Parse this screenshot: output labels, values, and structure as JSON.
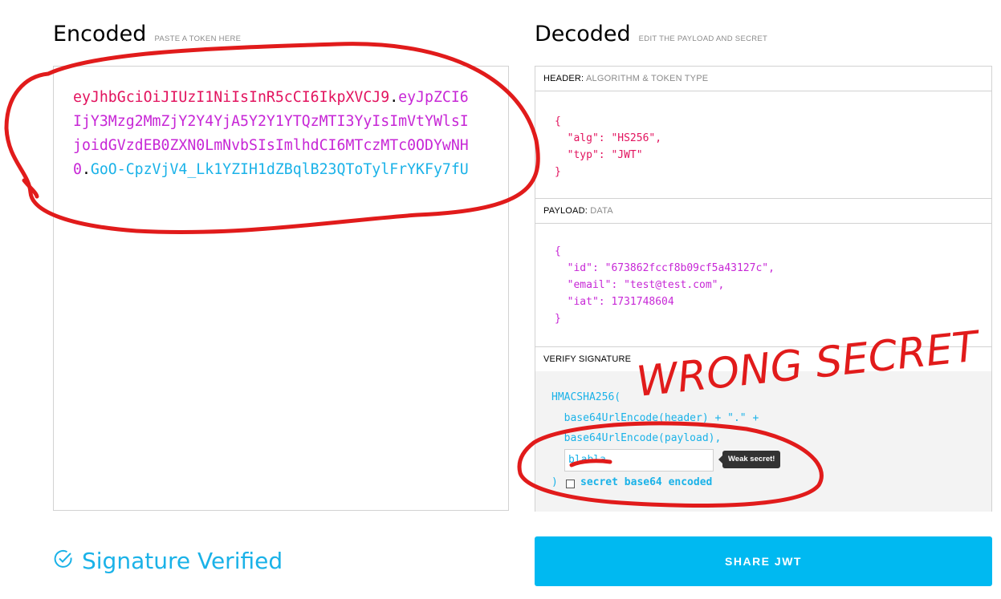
{
  "encoded": {
    "title": "Encoded",
    "subtitle": "PASTE A TOKEN HERE",
    "token": {
      "header": "eyJhbGciOiJIUzI1NiIsInR5cCI6IkpXVCJ9",
      "dot1": ".",
      "payload": "eyJpZCI6IjY3Mzg2MmZjY2Y4YjA5Y2Y1YTQzMTI3YyIsImVtYWlsIjoidGVzdEB0ZXN0LmNvbSIsImlhdCI6MTczMTc0ODYwNH0",
      "dot2": ".",
      "signature": "GoO-CpzVjV4_Lk1YZIH1dZBqlB23QToTylFrYKFy7fU"
    }
  },
  "decoded": {
    "title": "Decoded",
    "subtitle": "EDIT THE PAYLOAD AND SECRET",
    "header": {
      "title": "HEADER:",
      "sub": "ALGORITHM & TOKEN TYPE",
      "lines": [
        "{",
        "  \"alg\": \"HS256\",",
        "  \"typ\": \"JWT\"",
        "}"
      ]
    },
    "payload": {
      "title": "PAYLOAD:",
      "sub": "DATA",
      "lines": [
        "{",
        "  \"id\": \"673862fccf8b09cf5a43127c\",",
        "  \"email\": \"test@test.com\",",
        "  \"iat\": 1731748604",
        "}"
      ]
    },
    "verify": {
      "title": "VERIFY SIGNATURE",
      "fn": "HMACSHA256(",
      "line1": "  base64UrlEncode(header) + \".\" +",
      "line2": "  base64UrlEncode(payload),",
      "secret_value": "blabla",
      "weak_tooltip": "Weak secret!",
      "close": ")",
      "checkbox_label": "secret base64 encoded",
      "checkbox_checked": false
    }
  },
  "status": {
    "text": "Signature Verified",
    "color": "#1ab2e8"
  },
  "share_button": {
    "label": "SHARE JWT",
    "color": "#00b9f1"
  },
  "annotation": {
    "text": "WRONG SECRET",
    "color": "#e11b1b"
  }
}
